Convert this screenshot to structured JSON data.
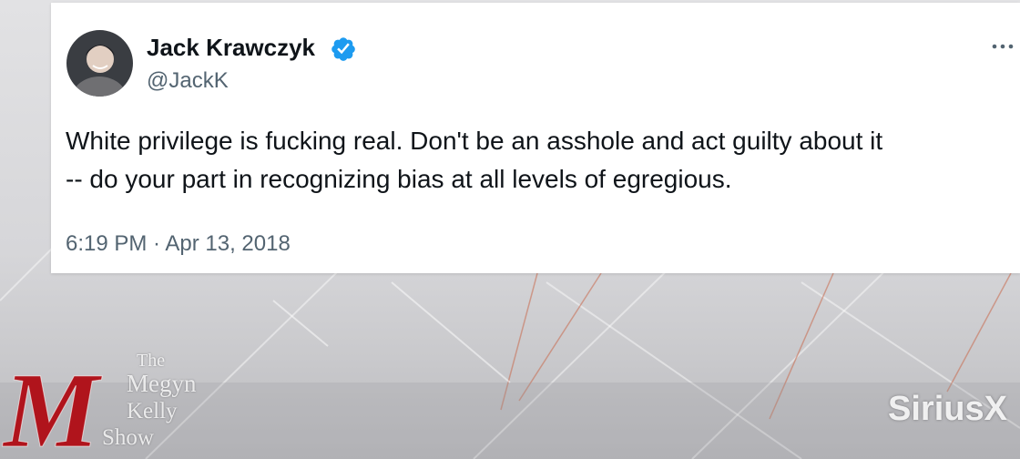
{
  "tweet": {
    "display_name": "Jack Krawczyk",
    "handle": "@JackK",
    "verified": true,
    "text_lines": [
      "White privilege is fucking real. Don't be an asshole and act guilty about it",
      "-- do your part in recognizing bias at all levels of egregious."
    ],
    "timestamp": "6:19 PM · Apr 13, 2018",
    "more_icon": "more-horizontal-icon",
    "verified_color": "#1d9bf0"
  },
  "overlay": {
    "show_logo": {
      "initial": "M",
      "line1": "The",
      "line2": "Megyn",
      "line3": "Kelly",
      "line4": "Show",
      "accent_color": "#b0141c"
    },
    "network_watermark": "SiriusX"
  }
}
